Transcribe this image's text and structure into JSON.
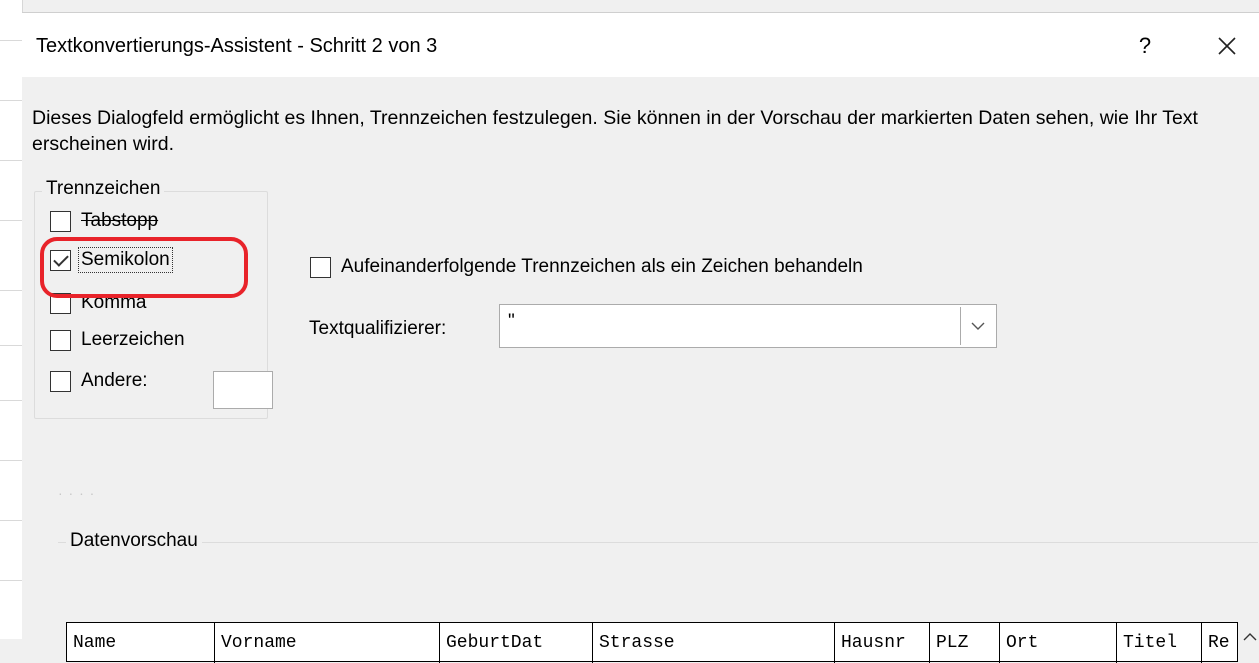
{
  "dialog": {
    "title": "Textkonvertierungs-Assistent - Schritt 2 von 3",
    "help_label": "?",
    "description": "Dieses Dialogfeld ermöglicht es Ihnen, Trennzeichen festzulegen. Sie können in der Vorschau der markierten Daten sehen, wie Ihr Text erscheinen wird."
  },
  "delimiters": {
    "group_label": "Trennzeichen",
    "tab": {
      "label": "Tabstopp",
      "checked": false
    },
    "semicolon": {
      "label": "Semikolon",
      "checked": true
    },
    "comma": {
      "label": "Komma",
      "checked": false
    },
    "space": {
      "label": "Leerzeichen",
      "checked": false
    },
    "other": {
      "label": "Andere:",
      "checked": false,
      "value": ""
    }
  },
  "consecutive": {
    "label": "Aufeinanderfolgende Trennzeichen als ein Zeichen behandeln",
    "checked": false
  },
  "qualifier": {
    "label": "Textqualifizierer:",
    "value": "\""
  },
  "preview": {
    "label": "Datenvorschau",
    "columns": [
      "Name",
      "Vorname",
      "GeburtDat",
      "Strasse",
      "Hausnr",
      "PLZ",
      "Ort",
      "Titel",
      "Re"
    ]
  },
  "colors": {
    "annotation": "#e8232a",
    "dialog_bg": "#f0f0f0"
  }
}
